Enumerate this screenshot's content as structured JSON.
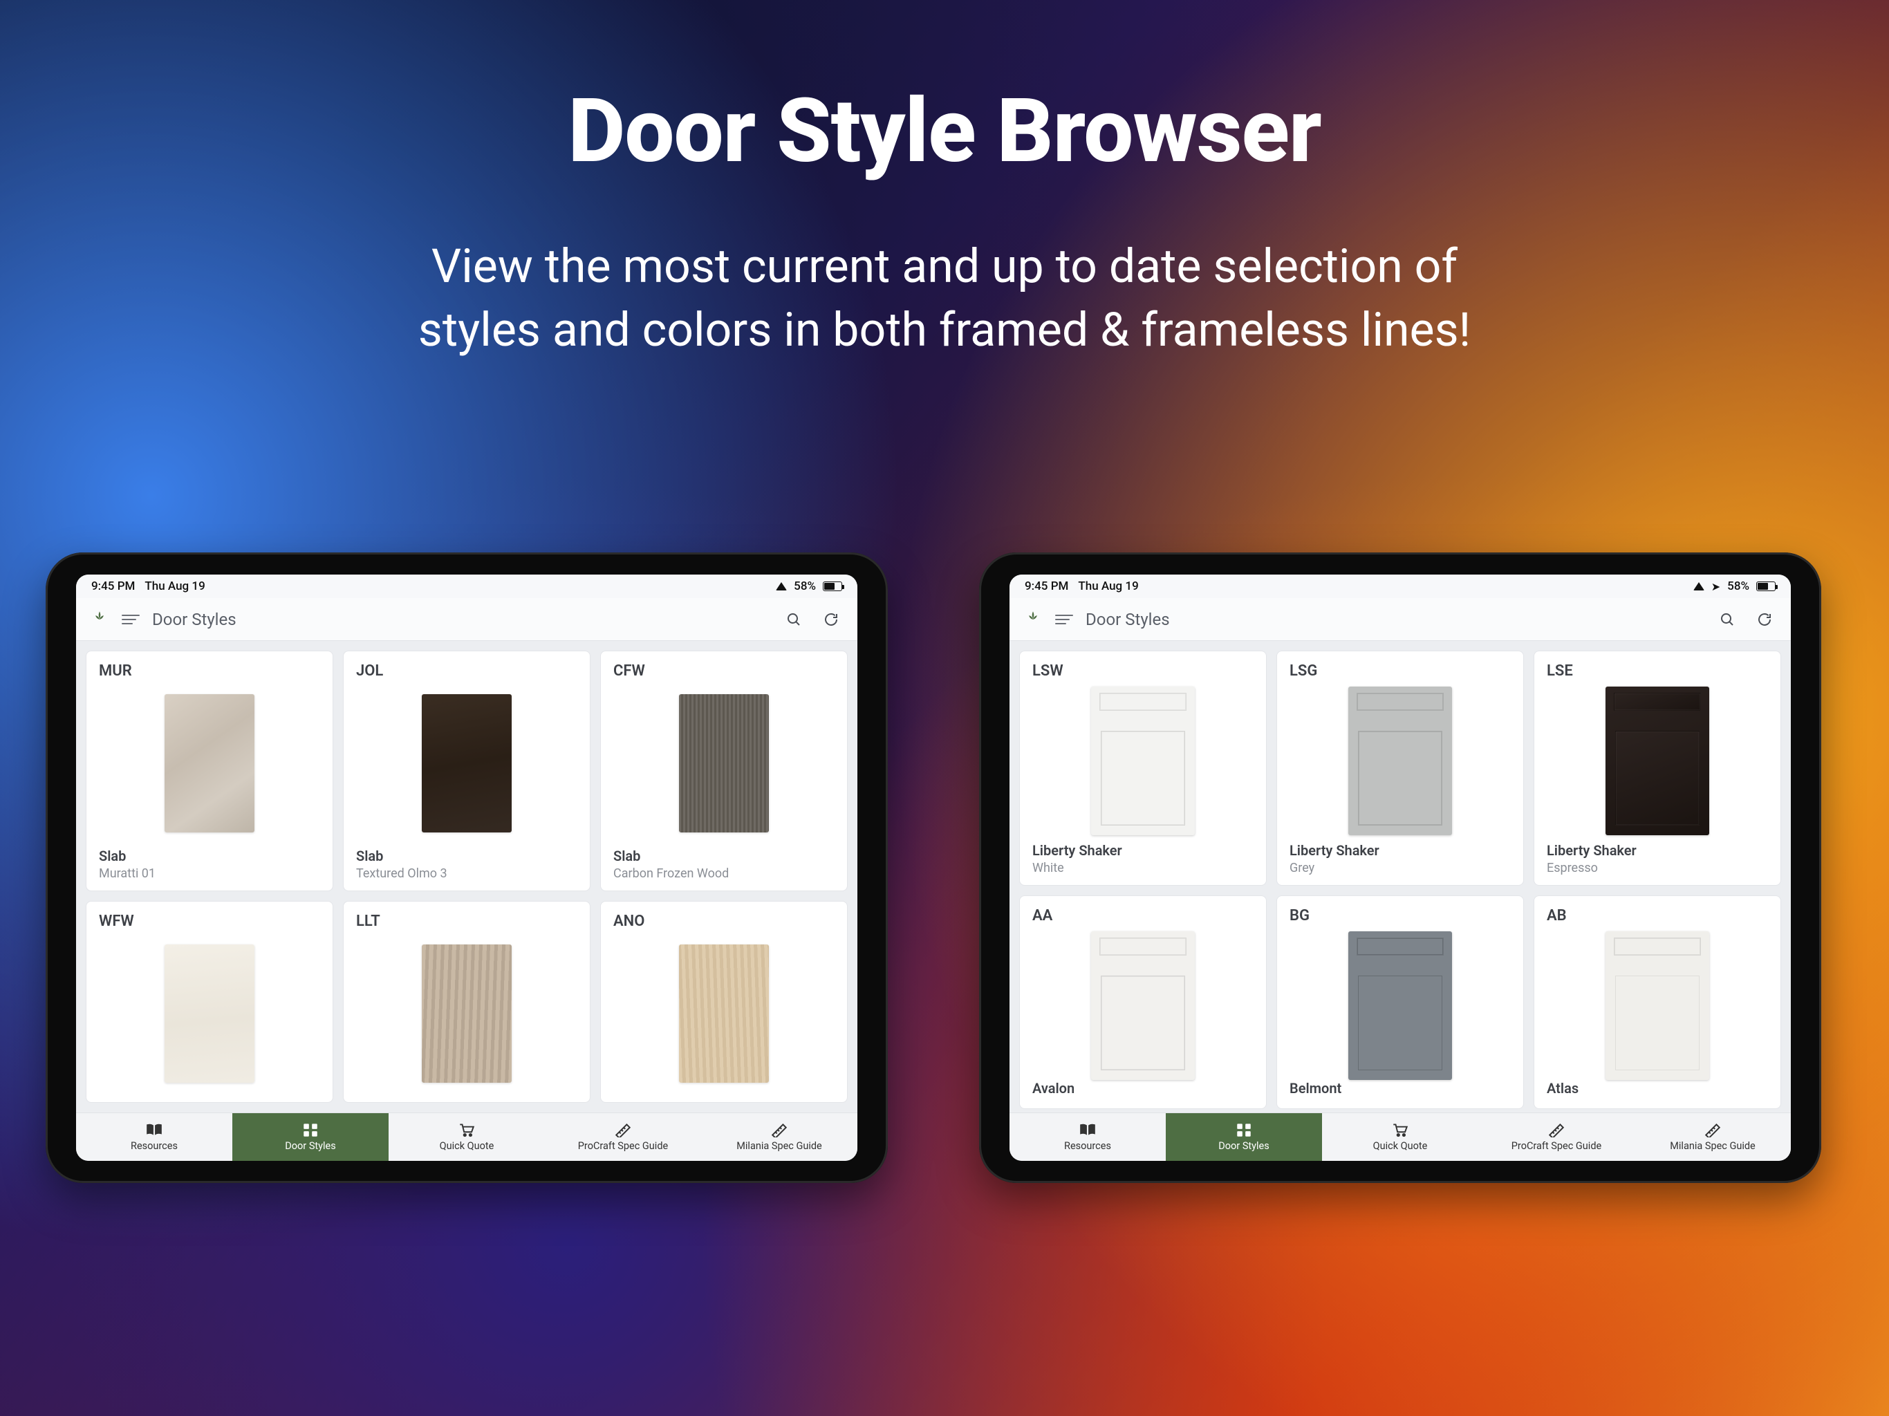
{
  "hero": {
    "title": "Door Style Browser",
    "subtitle_l1": "View the most current and up to date selection of",
    "subtitle_l2": "styles and colors in both framed & frameless lines!"
  },
  "status": {
    "time": "9:45 PM",
    "date": "Thu Aug 19",
    "battery_pct": "58%"
  },
  "appbar": {
    "title": "Door Styles"
  },
  "tabs": {
    "resources": "Resources",
    "door_styles": "Door Styles",
    "quick_quote": "Quick Quote",
    "procraft": "ProCraft Spec Guide",
    "milania": "Milania Spec Guide"
  },
  "devices": [
    {
      "show_location": false,
      "cards": [
        {
          "code": "MUR",
          "style": "Slab",
          "color": "Muratti 01",
          "swatch_css": "linear-gradient(145deg,#d9d0c4,#c7bdb0 40%,#d4ccc1 70%,#beb5a8)",
          "type": "flat"
        },
        {
          "code": "JOL",
          "style": "Slab",
          "color": "Textured Olmo 3",
          "swatch_css": "linear-gradient(170deg,#3a2d22,#2a1f16 50%,#342921)",
          "type": "flat"
        },
        {
          "code": "CFW",
          "style": "Slab",
          "color": "Carbon Frozen Wood",
          "swatch_css": "repeating-linear-gradient(90deg,#6f6a63 0 3px,#5d5850 3px 6px)",
          "type": "flat"
        },
        {
          "code": "WFW",
          "style": "",
          "color": "",
          "swatch_css": "linear-gradient(175deg,#f3efe6,#eae5da 55%,#f0ece3)",
          "type": "flat"
        },
        {
          "code": "LLT",
          "style": "",
          "color": "",
          "swatch_css": "repeating-linear-gradient(92deg,#c9b9a5 0 6px,#b6a693 6px 11px)",
          "type": "flat"
        },
        {
          "code": "ANO",
          "style": "",
          "color": "",
          "swatch_css": "repeating-linear-gradient(88deg,#e0cdae 0 5px,#d4bf9e 5px 10px)",
          "type": "flat"
        }
      ]
    },
    {
      "show_location": true,
      "cards": [
        {
          "code": "LSW",
          "style": "Liberty Shaker",
          "color": "White",
          "swatch_css": "#f3f3f1",
          "type": "shaker",
          "shade": "rgba(0,0,0,.06)"
        },
        {
          "code": "LSG",
          "style": "Liberty Shaker",
          "color": "Grey",
          "swatch_css": "#bfc1c0",
          "type": "shaker",
          "shade": "rgba(0,0,0,.10)"
        },
        {
          "code": "LSE",
          "style": "Liberty Shaker",
          "color": "Espresso",
          "swatch_css": "linear-gradient(160deg,#2c2320,#1b1411)",
          "type": "shaker",
          "shade": "rgba(255,255,255,.04)"
        },
        {
          "code": "AA",
          "style": "Avalon",
          "color": "",
          "swatch_css": "#f2f1ee",
          "type": "shaker",
          "shade": "rgba(0,0,0,.06)"
        },
        {
          "code": "BG",
          "style": "Belmont",
          "color": "",
          "swatch_css": "#7d848b",
          "type": "raised",
          "shade": "rgba(0,0,0,.18)"
        },
        {
          "code": "AB",
          "style": "Atlas",
          "color": "",
          "swatch_css": "#f0efeb",
          "type": "raised",
          "shade": "rgba(0,0,0,.07)"
        }
      ]
    }
  ]
}
